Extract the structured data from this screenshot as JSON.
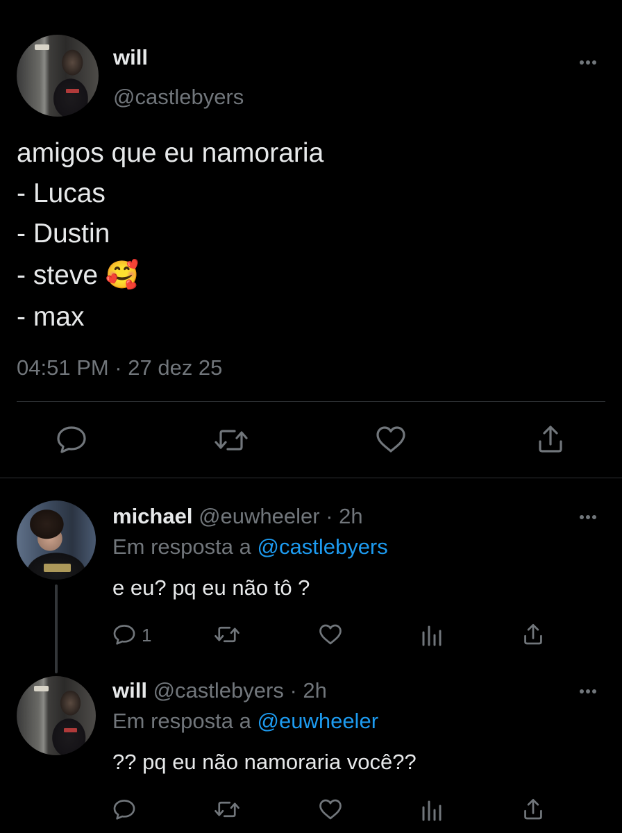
{
  "main_tweet": {
    "display_name": "will",
    "handle": "@castlebyers",
    "text_lines": [
      "amigos que eu namoraria",
      "- Lucas",
      "- Dustin",
      "- steve 🥰",
      "- max"
    ],
    "timestamp": "04:51 PM · 27 dez 25",
    "actions": [
      "reply-icon",
      "retweet-icon",
      "like-icon",
      "share-icon"
    ]
  },
  "replies": [
    {
      "display_name": "michael",
      "handle": "@euwheeler",
      "age": "· 2h",
      "replying_prefix": "Em resposta a",
      "replying_to": "@castlebyers",
      "text": "e eu? pq eu não tô ?",
      "reply_count": "1"
    },
    {
      "display_name": "will",
      "handle": "@castlebyers",
      "age": "· 2h",
      "replying_prefix": "Em resposta a",
      "replying_to": "@euwheeler",
      "text": "?? pq eu não namoraria você??",
      "reply_count": ""
    }
  ],
  "colors": {
    "background": "#000000",
    "text": "#e7e9ea",
    "secondary": "#71767b",
    "accent": "#1d9bf0",
    "divider": "#2f3336"
  }
}
